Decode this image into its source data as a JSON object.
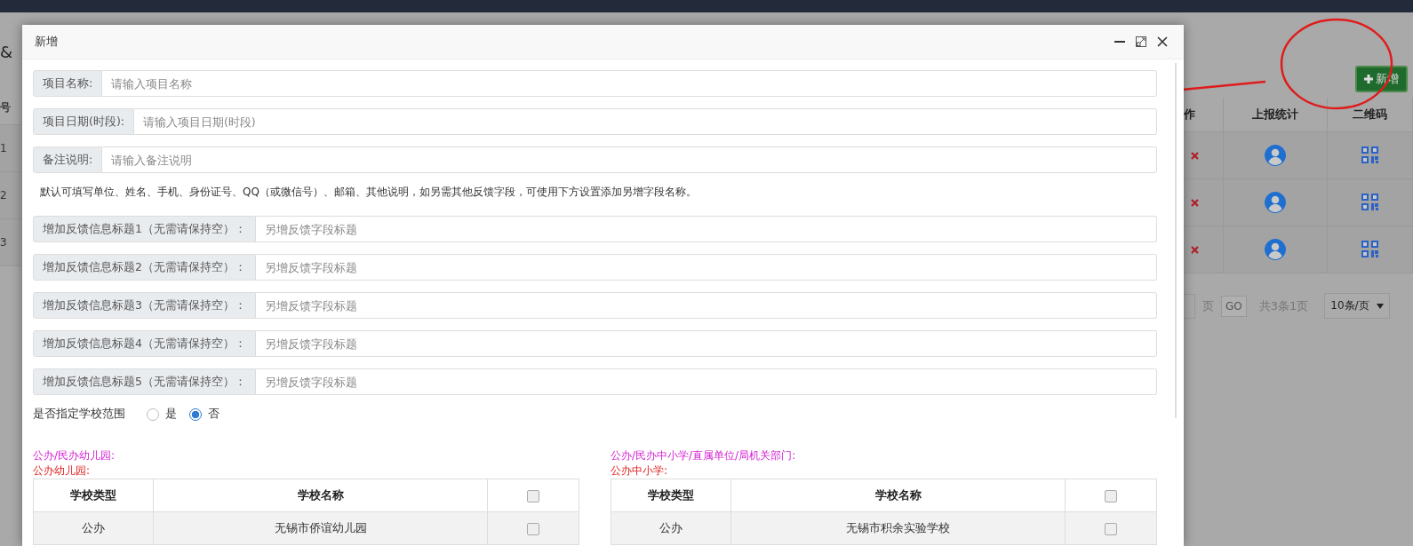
{
  "background": {
    "title_fragment": "&",
    "table": {
      "columns": [
        "号",
        "作",
        "上报统计",
        "二维码"
      ],
      "rows": [
        {
          "index": "1"
        },
        {
          "index": "2"
        },
        {
          "index": "3"
        }
      ]
    },
    "add_button": "新增",
    "pager": {
      "page_unit": "页",
      "go": "GO",
      "summary": "共3条1页",
      "page_size": "10条/页"
    }
  },
  "modal": {
    "title": "新增",
    "fields": [
      {
        "label": "项目名称:",
        "placeholder": "请输入项目名称"
      },
      {
        "label": "项目日期(时段):",
        "placeholder": "请输入项目日期(时段)"
      },
      {
        "label": "备注说明:",
        "placeholder": "请输入备注说明"
      }
    ],
    "note": "默认可填写单位、姓名、手机、身份证号、QQ（或微信号）、邮箱、其他说明，如另需其他反馈字段，可使用下方设置添加另增字段名称。",
    "extra_fields": [
      {
        "label": "增加反馈信息标题1（无需请保持空）：",
        "placeholder": "另增反馈字段标题"
      },
      {
        "label": "增加反馈信息标题2（无需请保持空）：",
        "placeholder": "另增反馈字段标题"
      },
      {
        "label": "增加反馈信息标题3（无需请保持空）：",
        "placeholder": "另增反馈字段标题"
      },
      {
        "label": "增加反馈信息标题4（无需请保持空）：",
        "placeholder": "另增反馈字段标题"
      },
      {
        "label": "增加反馈信息标题5（无需请保持空）：",
        "placeholder": "另增反馈字段标题"
      }
    ],
    "scope": {
      "label": "是否指定学校范围",
      "options": [
        {
          "label": "是",
          "selected": false
        },
        {
          "label": "否",
          "selected": true
        }
      ]
    },
    "school_groups": [
      {
        "category": "公办/民办幼儿园:",
        "subcategory": "公办幼儿园:",
        "columns": [
          "学校类型",
          "学校名称"
        ],
        "header_checked": false,
        "rows": [
          {
            "type": "公办",
            "name": "无锡市侨谊幼儿园",
            "checked": false
          }
        ]
      },
      {
        "category": "公办/民办中小学/直属单位/局机关部门:",
        "subcategory": "公办中小学:",
        "columns": [
          "学校类型",
          "学校名称"
        ],
        "header_checked": false,
        "rows": [
          {
            "type": "公办",
            "name": "无锡市积余实验学校",
            "checked": false
          }
        ]
      }
    ]
  }
}
